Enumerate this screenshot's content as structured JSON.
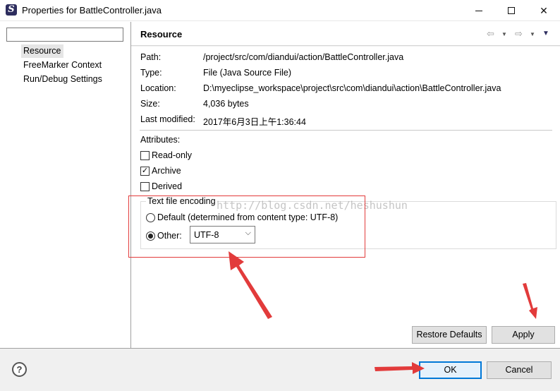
{
  "window": {
    "title": "Properties for BattleController.java",
    "app_icon_glyph": "S"
  },
  "sidebar": {
    "filter_value": "",
    "items": [
      {
        "label": "Resource",
        "selected": true
      },
      {
        "label": "FreeMarker Context",
        "selected": false
      },
      {
        "label": "Run/Debug Settings",
        "selected": false
      }
    ]
  },
  "page": {
    "title": "Resource",
    "nav_back_icon": "arrow-left-icon",
    "nav_forward_icon": "arrow-right-icon"
  },
  "info": {
    "path_label": "Path:",
    "path_value": "/project/src/com/diandui/action/BattleController.java",
    "type_label": "Type:",
    "type_value": "File  (Java Source File)",
    "location_label": "Location:",
    "location_value": "D:\\myeclipse_workspace\\project\\src\\com\\diandui\\action\\BattleController.java",
    "size_label": "Size:",
    "size_value": "4,036  bytes",
    "modified_label": "Last modified:",
    "modified_value": "2017年6月3日上午1:36:44"
  },
  "attributes": {
    "heading": "Attributes:",
    "read_only": {
      "label": "Read-only",
      "checked": false
    },
    "archive": {
      "label": "Archive",
      "checked": true
    },
    "derived": {
      "label": "Derived",
      "checked": false
    }
  },
  "encoding": {
    "group_title": "Text file encoding",
    "default_label": "Default (determined from content type: UTF-8)",
    "other_label": "Other:",
    "selected_option": "other",
    "other_value": "UTF-8"
  },
  "buttons": {
    "restore_defaults": "Restore Defaults",
    "apply": "Apply",
    "ok": "OK",
    "cancel": "Cancel",
    "help_glyph": "?"
  },
  "watermark": "http://blog.csdn.net/heshushun",
  "colors": {
    "annotation_red": "#e23b3b",
    "focus_blue": "#0078d7"
  }
}
